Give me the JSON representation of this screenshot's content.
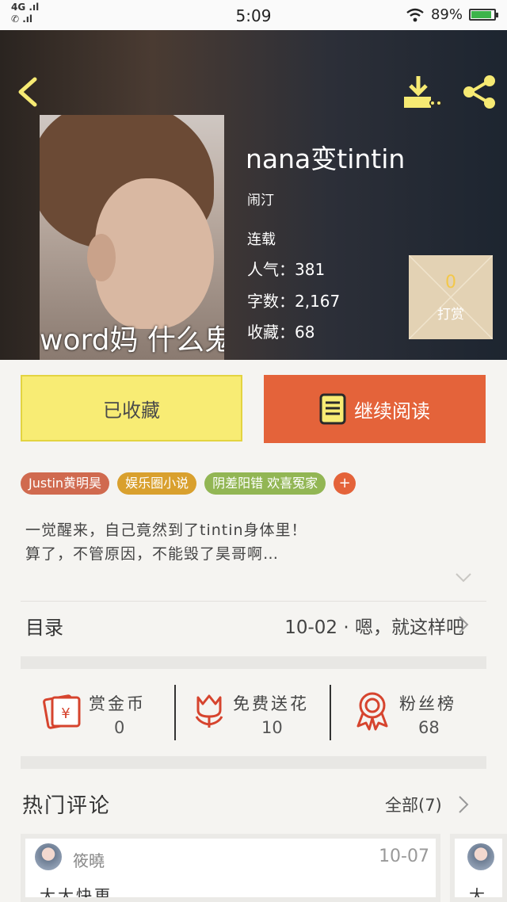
{
  "status_bar": {
    "network_top": "4G",
    "time": "5:09",
    "battery": "89%",
    "battery_level": 0.89
  },
  "book": {
    "title": "nana变tintin",
    "author": "闹汀",
    "status": "连载",
    "popularity_label": "人气：",
    "popularity": "381",
    "word_count_label": "字数：",
    "word_count": "2,167",
    "favorites_label": "收藏：",
    "favorites": "68",
    "cover_caption": "word妈 什么鬼"
  },
  "tip": {
    "count": "0",
    "label": "打赏"
  },
  "actions": {
    "collect_label": "已收藏",
    "read_label": "继续阅读"
  },
  "tags": [
    {
      "label": "Justin黄明昊",
      "color": "#d06a4f"
    },
    {
      "label": "娱乐圈小说",
      "color": "#d9a02e"
    },
    {
      "label": "阴差阳错 欢喜冤家",
      "color": "#92b654"
    }
  ],
  "tag_more": "+",
  "synopsis": {
    "line1": "一觉醒来，自己竟然到了tintin身体里！",
    "line2": "算了，不管原因，不能毁了昊哥啊…"
  },
  "toc": {
    "label": "目录",
    "latest_chapter": "10-02 · 嗯，就这样吧"
  },
  "rewards": [
    {
      "label": "赏金币",
      "value": "0",
      "icon": "gold-coin-icon"
    },
    {
      "label": "免费送花",
      "value": "10",
      "icon": "flower-icon"
    },
    {
      "label": "粉丝榜",
      "value": "68",
      "icon": "fan-ranking-icon"
    }
  ],
  "comments": {
    "title": "热门评论",
    "all_label": "全部(7)",
    "items": [
      {
        "user": "筱曉",
        "date": "10-07",
        "text": "大大快更"
      },
      {
        "user": "",
        "date": "",
        "text": "大"
      }
    ]
  },
  "colors": {
    "accent_orange": "#e4633a",
    "collect_yellow": "#f8ec74",
    "icon_yellow": "#f6ea73",
    "reward_red": "#d6442e"
  }
}
